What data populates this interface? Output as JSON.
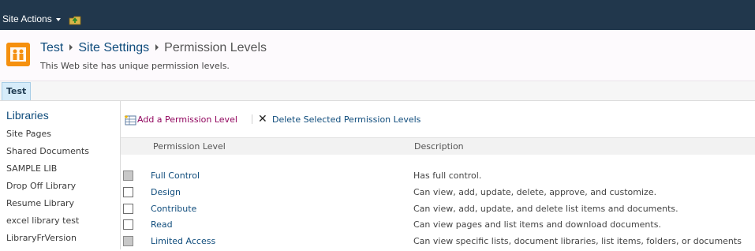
{
  "ribbon": {
    "site_actions_label": "Site Actions"
  },
  "header": {
    "breadcrumb": [
      "Test",
      "Site Settings",
      "Permission Levels"
    ],
    "description": "This Web site has unique permission levels."
  },
  "topnav": {
    "tabs": [
      "Test"
    ]
  },
  "quicklaunch": {
    "heading": "Libraries",
    "items": [
      "Site Pages",
      "Shared Documents",
      "SAMPLE LIB",
      "Drop Off Library",
      "Resume Library",
      "excel library test",
      "LibraryFrVersion"
    ]
  },
  "toolbar": {
    "add_label": "Add a Permission Level",
    "delete_label": "Delete Selected Permission Levels"
  },
  "table": {
    "columns": [
      "Permission Level",
      "Description"
    ],
    "rows": [
      {
        "name": "Full Control",
        "description": "Has full control.",
        "checkbox_disabled": true
      },
      {
        "name": "Design",
        "description": "Can view, add, update, delete, approve, and customize.",
        "checkbox_disabled": false
      },
      {
        "name": "Contribute",
        "description": "Can view, add, update, and delete list items and documents.",
        "checkbox_disabled": false
      },
      {
        "name": "Read",
        "description": "Can view pages and list items and download documents.",
        "checkbox_disabled": false
      },
      {
        "name": "Limited Access",
        "description": "Can view specific lists, document libraries, list items, folders, or documents",
        "checkbox_disabled": true
      }
    ]
  }
}
